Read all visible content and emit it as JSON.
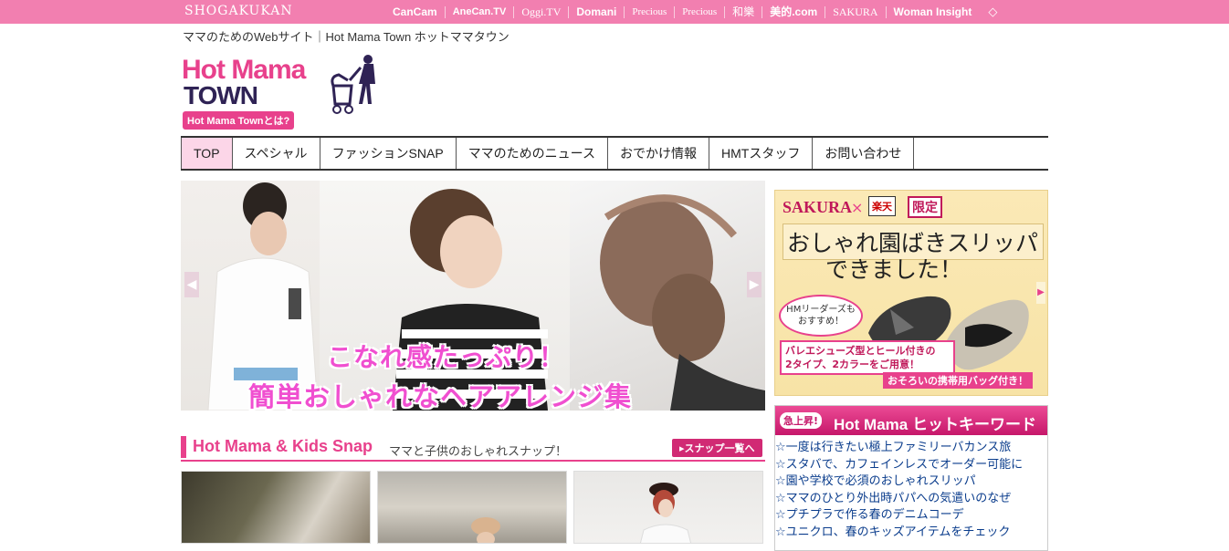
{
  "topbar": {
    "brand": "SHOGAKUKAN",
    "links": [
      "CanCam",
      "AneCan.TV",
      "Oggi.TV",
      "Domani",
      "Precious",
      "Precious",
      "和樂",
      "美的.com",
      "SAKURA",
      "Woman Insight"
    ],
    "gem_icon": "diamond-icon",
    "bg_color": "#f27fb0"
  },
  "tagline": "ママのためのWebサイト｜Hot Mama Town ホットママタウン",
  "logo": {
    "line1": "Hot Mama",
    "line2": "TOWN",
    "about": "Hot Mama Townとは?"
  },
  "nav": {
    "items": [
      "TOP",
      "スペシャル",
      "ファッションSNAP",
      "ママのためのニュース",
      "おでかけ情報",
      "HMTスタッフ",
      "お問い合わせ"
    ],
    "active": "TOP"
  },
  "hero": {
    "caption_line1": "こなれ感たっぷり！",
    "caption_line2": "簡単おしゃれなヘアアレンジ集",
    "prev_icon": "chevron-left-icon",
    "next_icon": "chevron-right-icon"
  },
  "snap": {
    "title": "Hot Mama & Kids Snap",
    "subtitle": "ママと子供のおしゃれスナップ！",
    "more": "▸スナップ一覧へ"
  },
  "ad": {
    "brand": "SAKURA",
    "cross": "×",
    "partner": "楽天",
    "limited": "限定",
    "headline1": "おしゃれ園ばきスリッパ",
    "headline2": "できました！",
    "bubble_line1": "HMリーダーズも",
    "bubble_line2": "おすすめ！",
    "box_line1": "バレエシューズ型とヒール付きの",
    "box_line2": "2タイプ、2カラーをご用意！",
    "bag": "おそろいの携帯用バッグ付き！",
    "accent_color": "#e8418c"
  },
  "keywords": {
    "badge": "急上昇!",
    "title": "Hot Mama ヒットキーワード",
    "items": [
      "☆一度は行きたい極上ファミリーバカンス旅",
      "☆スタバで、カフェインレスでオーダー可能に",
      "☆園や学校で必須のおしゃれスリッパ",
      "☆ママのひとり外出時パパへの気遣いのなぜ",
      "☆プチプラで作る春のデニムコーデ",
      "☆ユニクロ、春のキッズアイテムをチェック"
    ]
  }
}
